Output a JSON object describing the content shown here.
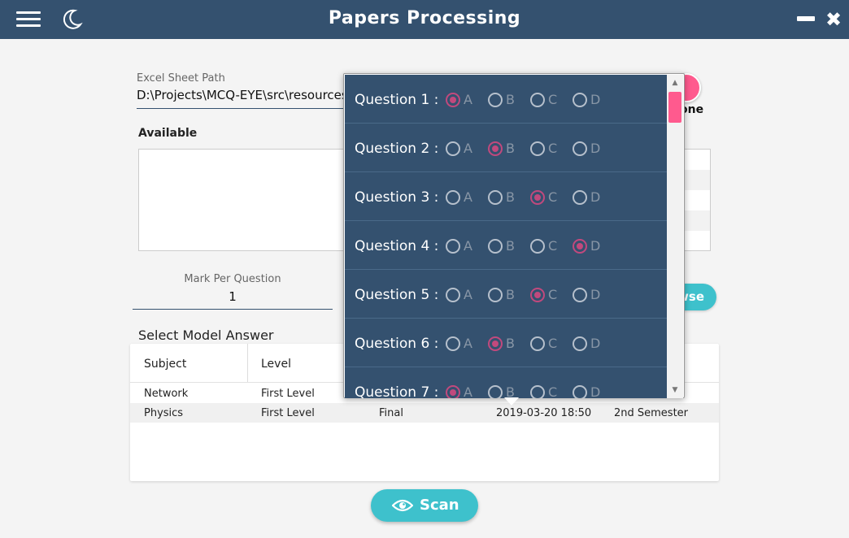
{
  "header": {
    "title": "Papers Processing",
    "icons": [
      "menu-icon",
      "moon-icon",
      "minimize-icon",
      "close-icon"
    ]
  },
  "excel": {
    "label": "Excel Sheet Path",
    "value": "D:\\Projects\\MCQ-EYE\\src\\resources"
  },
  "done": {
    "label": "Done"
  },
  "available": {
    "label": "Available"
  },
  "mark": {
    "label": "Mark Per Question",
    "value": "1"
  },
  "browse": {
    "label": "Browse"
  },
  "model_answer": {
    "label": "Select Model Answer",
    "columns": [
      "Subject",
      "Level"
    ],
    "rows": [
      {
        "subject": "Network",
        "level": "First Level",
        "type": "",
        "date": "",
        "semester": ""
      },
      {
        "subject": "Physics",
        "level": "First Level",
        "type": "Final",
        "date": "2019-03-20 18:50",
        "semester": "2nd Semester"
      }
    ]
  },
  "scan": {
    "label": "Scan",
    "icon": "eye-icon"
  },
  "answers": {
    "options": [
      "A",
      "B",
      "C",
      "D"
    ],
    "questions": [
      {
        "label": "Question 1 :",
        "selected": "A"
      },
      {
        "label": "Question 2 :",
        "selected": "B"
      },
      {
        "label": "Question 3 :",
        "selected": "C"
      },
      {
        "label": "Question 4 :",
        "selected": "D"
      },
      {
        "label": "Question 5 :",
        "selected": "C"
      },
      {
        "label": "Question 6 :",
        "selected": "B"
      },
      {
        "label": "Question 7 :",
        "selected": "A"
      }
    ]
  },
  "colors": {
    "header": "#34516f",
    "accent": "#3ec1cc",
    "pink": "#ff5a8e",
    "selected_radio": "#c1497d"
  }
}
